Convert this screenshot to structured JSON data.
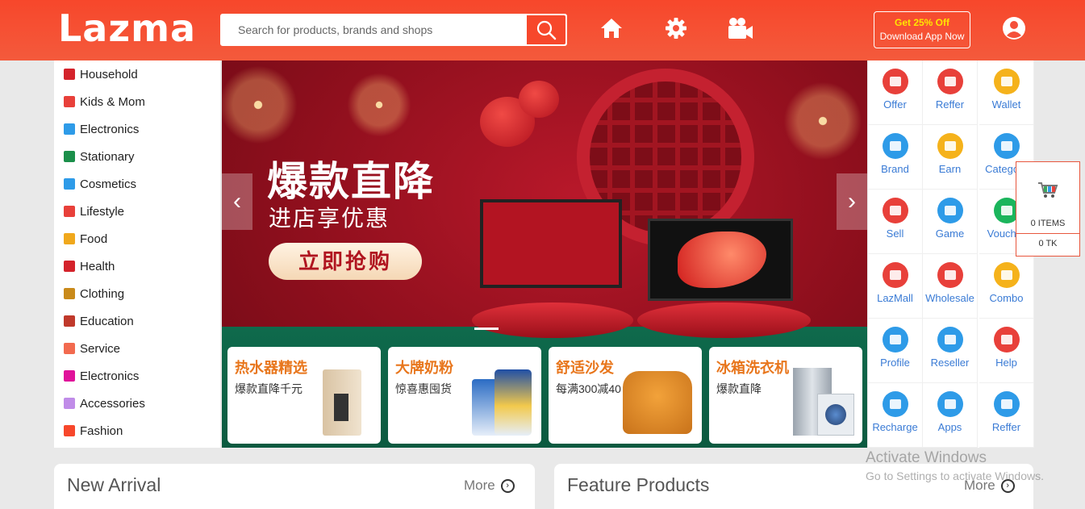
{
  "header": {
    "logo": "Lazma",
    "search": {
      "placeholder": "Search for products, brands and shops"
    },
    "icons": [
      "search-icon",
      "home-icon",
      "gear-icon",
      "video-camera-icon",
      "user-account-icon"
    ],
    "app_promo": {
      "line1": "Get 25% Off",
      "line2": "Download App Now"
    }
  },
  "categories": [
    {
      "label": "Household",
      "color": "#d4232b"
    },
    {
      "label": "Kids & Mom",
      "color": "#e8403a"
    },
    {
      "label": "Electronics",
      "color": "#2e9be8"
    },
    {
      "label": "Stationary",
      "color": "#1b8f4a"
    },
    {
      "label": "Cosmetics",
      "color": "#2e9be8"
    },
    {
      "label": "Lifestyle",
      "color": "#e8403a"
    },
    {
      "label": "Food",
      "color": "#f0a81c"
    },
    {
      "label": "Health",
      "color": "#d4232b"
    },
    {
      "label": "Clothing",
      "color": "#c98a1a"
    },
    {
      "label": "Education",
      "color": "#c0392b"
    },
    {
      "label": "Service",
      "color": "#f26a4f"
    },
    {
      "label": "Electronics",
      "color": "#e0129a"
    },
    {
      "label": "Accessories",
      "color": "#c08ce8"
    },
    {
      "label": "Fashion",
      "color": "#f7472b"
    }
  ],
  "banner": {
    "headline": "爆款直降",
    "subline": "进店享优惠",
    "cta": "立即抢购",
    "cards": [
      {
        "title": "热水器精选",
        "subtitle": "爆款直降千元"
      },
      {
        "title": "大牌奶粉",
        "subtitle": "惊喜惠囤货"
      },
      {
        "title": "舒适沙发",
        "subtitle": "每满300减40"
      },
      {
        "title": "冰箱洗衣机",
        "subtitle": "爆款直降"
      }
    ]
  },
  "quick_links": [
    {
      "label": "Offer",
      "icon": "gift-box-icon",
      "color": "#e8403a"
    },
    {
      "label": "Reffer",
      "icon": "handshake-icon",
      "color": "#e8403a"
    },
    {
      "label": "Wallet",
      "icon": "wallet-icon",
      "color": "#f5b21b"
    },
    {
      "label": "Brand",
      "icon": "diamond-icon",
      "color": "#2e9be8"
    },
    {
      "label": "Earn",
      "icon": "ticket-icon",
      "color": "#f5b21b"
    },
    {
      "label": "Category",
      "icon": "phone-yen-icon",
      "color": "#2e9be8"
    },
    {
      "label": "Sell",
      "icon": "wallet-red-icon",
      "color": "#e8403a"
    },
    {
      "label": "Game",
      "icon": "new-bubble-icon",
      "color": "#2e9be8"
    },
    {
      "label": "Voucher",
      "icon": "shield-icon",
      "color": "#1bb55c"
    },
    {
      "label": "LazMall",
      "icon": "gift-box-icon",
      "color": "#e8403a"
    },
    {
      "label": "Wholesale",
      "icon": "handshake-icon",
      "color": "#e8403a"
    },
    {
      "label": "Combo",
      "icon": "flame-drop-icon",
      "color": "#f5b21b"
    },
    {
      "label": "Profile",
      "icon": "card-icon",
      "color": "#2e9be8"
    },
    {
      "label": "Reseller",
      "icon": "new-bubble-icon",
      "color": "#2e9be8"
    },
    {
      "label": "Help",
      "icon": "wallet-red-icon",
      "color": "#e8403a"
    },
    {
      "label": "Recharge",
      "icon": "phone-yen-icon",
      "color": "#2e9be8"
    },
    {
      "label": "Apps",
      "icon": "card-icon",
      "color": "#2e9be8"
    },
    {
      "label": "Reffer",
      "icon": "medical-kit-icon",
      "color": "#2e9be8"
    }
  ],
  "cart": {
    "items": "0 ITEMS",
    "total": "0 TK"
  },
  "sections": [
    {
      "title": "New Arrival",
      "more": "More"
    },
    {
      "title": "Feature Products",
      "more": "More"
    }
  ],
  "os_watermark": {
    "line1": "Activate Windows",
    "line2": "Go to Settings to activate Windows."
  },
  "colors": {
    "brand": "#f7472b",
    "link": "#3a7bd5",
    "promo_yellow": "#ffe600"
  }
}
